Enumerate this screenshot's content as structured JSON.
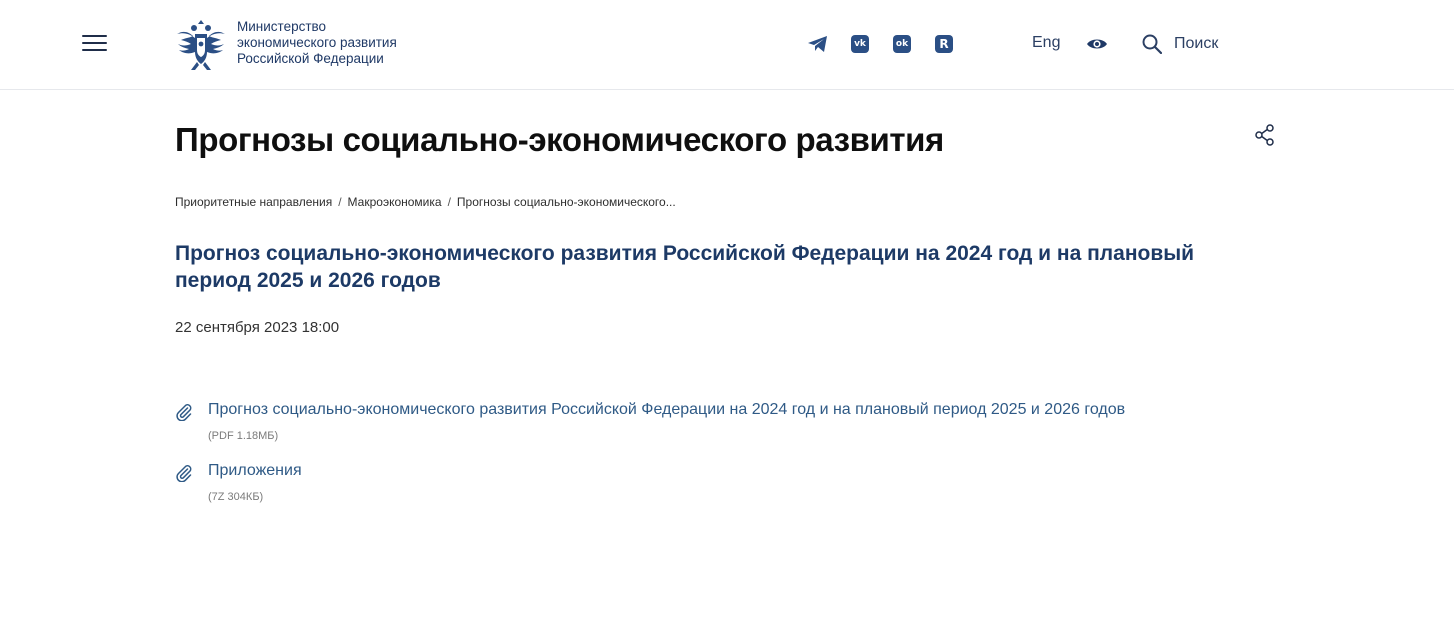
{
  "header": {
    "logo_lines": [
      "Министерство",
      "экономического развития",
      "Российской Федерации"
    ],
    "social": [
      {
        "name": "telegram-icon",
        "letter": ""
      },
      {
        "name": "vk-icon",
        "letter": "vk"
      },
      {
        "name": "odnoklassniki-icon",
        "letter": "ok"
      },
      {
        "name": "rutube-icon",
        "letter": "R"
      }
    ],
    "lang_label": "Eng",
    "search_label": "Поиск"
  },
  "page": {
    "title": "Прогнозы социально-экономического развития",
    "breadcrumb": [
      "Приоритетные направления",
      "Макроэкономика",
      "Прогнозы социально-экономического..."
    ]
  },
  "document": {
    "title": "Прогноз социально-экономического развития Российской Федерации на 2024 год и на плановый период 2025 и 2026 годов",
    "date": "22 сентября 2023 18:00",
    "attachments": [
      {
        "label": "Прогноз социально-экономического развития Российской Федерации на 2024 год и на плановый период 2025 и 2026 годов",
        "meta": "(PDF 1.18МБ)"
      },
      {
        "label": "Приложения",
        "meta": "(7Z 304КБ)"
      }
    ]
  },
  "colors": {
    "brand": "#1d3a66",
    "link": "#2f5a86",
    "icon": "#2b4f85"
  }
}
